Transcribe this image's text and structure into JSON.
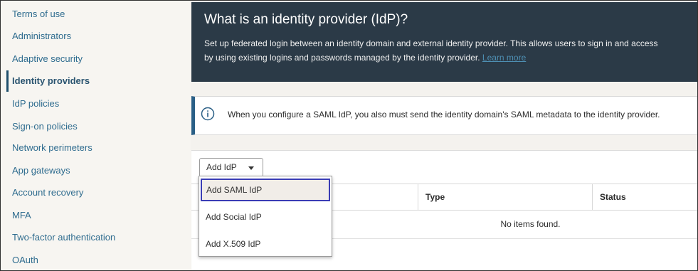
{
  "sidebar": {
    "items": [
      {
        "label": "Terms of use"
      },
      {
        "label": "Administrators"
      },
      {
        "label": "Adaptive security"
      },
      {
        "label": "Identity providers"
      },
      {
        "label": "IdP policies"
      },
      {
        "label": "Sign-on policies"
      },
      {
        "label": "Network perimeters"
      },
      {
        "label": "App gateways"
      },
      {
        "label": "Account recovery"
      },
      {
        "label": "MFA"
      },
      {
        "label": "Two-factor authentication"
      },
      {
        "label": "OAuth"
      }
    ],
    "active_label": "Identity providers"
  },
  "hero": {
    "title": "What is an identity provider (IdP)?",
    "line1": "Set up federated login between an identity domain and external identity provider. This allows users to sign in and access",
    "line2": "by using existing logins and passwords managed by the identity provider.",
    "link": "Learn more"
  },
  "info": {
    "text": "When you configure a SAML IdP, you also must send the identity domain's SAML metadata to the identity provider."
  },
  "toolbar": {
    "add_idp_label": "Add IdP"
  },
  "table": {
    "columns": [
      "Type",
      "Status"
    ],
    "empty_message": "No items found."
  },
  "dropdown": {
    "items": [
      "Add SAML IdP",
      "Add Social IdP",
      "Add X.509 IdP"
    ],
    "selected": "Add SAML IdP"
  },
  "colors": {
    "hero_bg": "#2b3a47",
    "link": "#2f6c8f",
    "info_accent": "#2a5f86",
    "selection_outline": "#3a3db5"
  }
}
